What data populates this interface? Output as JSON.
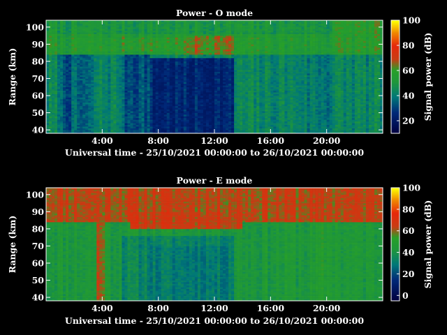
{
  "chart_data": [
    {
      "type": "heatmap",
      "title": "Power - O mode",
      "xlabel": "Universal time - 25/10/2021 00:00:00 to 26/10/2021 00:00:00",
      "ylabel": "Range (km)",
      "xlim": [
        0,
        24
      ],
      "ylim": [
        38,
        104
      ],
      "x_ticks": [
        "4:00",
        "8:00",
        "12:00",
        "16:00",
        "20:00"
      ],
      "x_tick_values": [
        4,
        8,
        12,
        16,
        20
      ],
      "y_ticks": [
        "40",
        "50",
        "60",
        "70",
        "80",
        "90",
        "100"
      ],
      "y_tick_values": [
        40,
        50,
        60,
        70,
        80,
        90,
        100
      ],
      "colorbar_label": "Signal power (dB)",
      "colorbar_ticks": [
        "20",
        "40",
        "60",
        "80",
        "100"
      ],
      "colorbar_tick_values": [
        20,
        40,
        60,
        80,
        100
      ],
      "colorbar_range": [
        10,
        100
      ],
      "background_level": 44,
      "regions": [
        {
          "t": [
            0,
            24
          ],
          "h": [
            38,
            104
          ],
          "level": 43
        },
        {
          "t": [
            0,
            24
          ],
          "h": [
            84,
            96
          ],
          "level": 55
        },
        {
          "t": [
            5.5,
            13
          ],
          "h": [
            86,
            94
          ],
          "level": 58
        },
        {
          "t": [
            10,
            13.5
          ],
          "h": [
            84,
            95
          ],
          "level": 64
        },
        {
          "t": [
            0,
            24
          ],
          "h": [
            96,
            104
          ],
          "level": 50
        },
        {
          "t": [
            1.0,
            3.5
          ],
          "h": [
            38,
            84
          ],
          "level": 34
        },
        {
          "t": [
            5.5,
            7.5
          ],
          "h": [
            38,
            84
          ],
          "level": 33
        },
        {
          "t": [
            7.5,
            13.5
          ],
          "h": [
            38,
            82
          ],
          "level": 24
        },
        {
          "t": [
            18.5,
            20.5
          ],
          "h": [
            38,
            84
          ],
          "level": 40
        },
        {
          "t": [
            20.5,
            24
          ],
          "h": [
            84,
            104
          ],
          "level": 57
        }
      ],
      "value_range": [
        20,
        76
      ],
      "seed": 7
    },
    {
      "type": "heatmap",
      "title": "Power - E mode",
      "xlabel": "Universal time - 25/10/2021 00:00:00 to 26/10/2021 00:00:00",
      "ylabel": "Range (km)",
      "xlim": [
        0,
        24
      ],
      "ylim": [
        38,
        104
      ],
      "x_ticks": [
        "4:00",
        "8:00",
        "12:00",
        "16:00",
        "20:00"
      ],
      "x_tick_values": [
        4,
        8,
        12,
        16,
        20
      ],
      "y_ticks": [
        "40",
        "50",
        "60",
        "70",
        "80",
        "90",
        "100"
      ],
      "y_tick_values": [
        40,
        50,
        60,
        70,
        80,
        90,
        100
      ],
      "colorbar_label": "Signal power (dB)",
      "colorbar_ticks": [
        "0",
        "20",
        "40",
        "60",
        "80",
        "100"
      ],
      "colorbar_tick_values": [
        0,
        20,
        40,
        60,
        80,
        100
      ],
      "colorbar_range": [
        -5,
        100
      ],
      "background_level": 45,
      "regions": [
        {
          "t": [
            0,
            24
          ],
          "h": [
            38,
            104
          ],
          "level": 44
        },
        {
          "t": [
            0,
            24
          ],
          "h": [
            84,
            104
          ],
          "level": 64
        },
        {
          "t": [
            6,
            14
          ],
          "h": [
            80,
            90
          ],
          "level": 66
        },
        {
          "t": [
            5.5,
            13.5
          ],
          "h": [
            38,
            76
          ],
          "level": 34
        },
        {
          "t": [
            7.5,
            13
          ],
          "h": [
            38,
            70
          ],
          "level": 30
        },
        {
          "t": [
            3.6,
            4.2
          ],
          "h": [
            38,
            90
          ],
          "level": 62
        },
        {
          "t": [
            19.5,
            21
          ],
          "h": [
            38,
            84
          ],
          "level": 47
        }
      ],
      "value_range": [
        25,
        80
      ],
      "seed": 11
    }
  ]
}
